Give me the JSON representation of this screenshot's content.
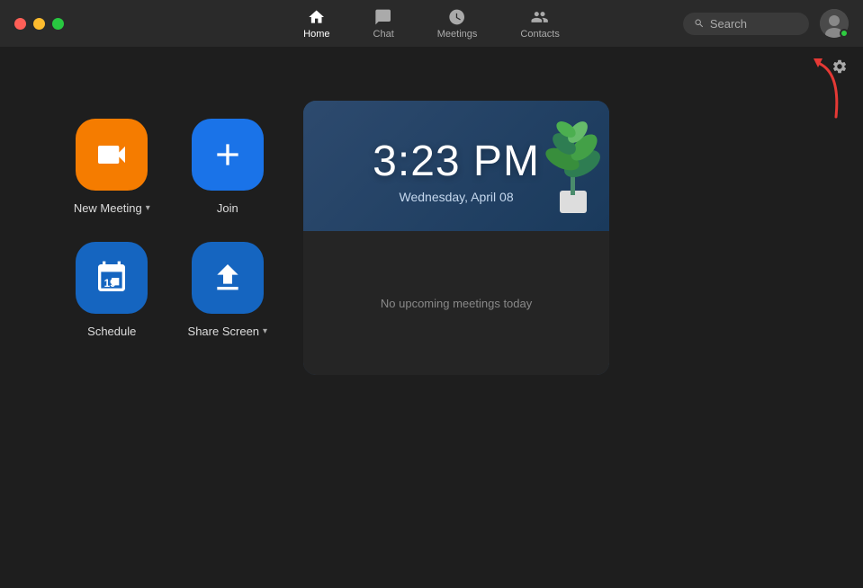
{
  "window": {
    "traffic_lights": [
      "red",
      "yellow",
      "green"
    ]
  },
  "nav": {
    "tabs": [
      {
        "id": "home",
        "label": "Home",
        "active": true
      },
      {
        "id": "chat",
        "label": "Chat",
        "active": false
      },
      {
        "id": "meetings",
        "label": "Meetings",
        "active": false
      },
      {
        "id": "contacts",
        "label": "Contacts",
        "active": false
      }
    ]
  },
  "search": {
    "placeholder": "Search"
  },
  "settings": {
    "icon": "⚙"
  },
  "actions": [
    {
      "id": "new-meeting",
      "label": "New Meeting",
      "has_dropdown": true,
      "color": "orange"
    },
    {
      "id": "join",
      "label": "Join",
      "has_dropdown": false,
      "color": "blue"
    },
    {
      "id": "schedule",
      "label": "Schedule",
      "has_dropdown": false,
      "color": "blue2"
    },
    {
      "id": "share-screen",
      "label": "Share Screen",
      "has_dropdown": true,
      "color": "blue2"
    }
  ],
  "clock": {
    "time": "3:23 PM",
    "date": "Wednesday, April 08"
  },
  "meetings_panel": {
    "empty_message": "No upcoming meetings today"
  }
}
